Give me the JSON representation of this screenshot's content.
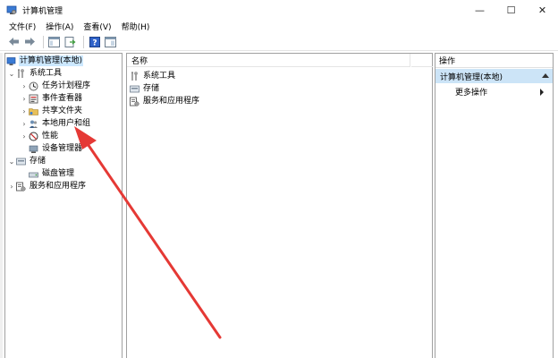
{
  "window": {
    "title": "计算机管理",
    "minimize": "—",
    "maximize": "☐",
    "close": "✕"
  },
  "menu": [
    "文件(F)",
    "操作(A)",
    "查看(V)",
    "帮助(H)"
  ],
  "tree": {
    "root": "计算机管理(本地)",
    "system_tools": "系统工具",
    "task_scheduler": "任务计划程序",
    "event_viewer": "事件查看器",
    "shared_folders": "共享文件夹",
    "local_users": "本地用户和组",
    "performance": "性能",
    "device_manager": "设备管理器",
    "storage": "存储",
    "disk_management": "磁盘管理",
    "services_apps": "服务和应用程序"
  },
  "list": {
    "column_name": "名称",
    "items": [
      "系统工具",
      "存储",
      "服务和应用程序"
    ]
  },
  "actions": {
    "header": "操作",
    "group": "计算机管理(本地)",
    "more": "更多操作"
  },
  "colors": {
    "selection": "#cce8ff",
    "actions_group": "#cce4f7",
    "annotation_arrow": "#e53935"
  }
}
